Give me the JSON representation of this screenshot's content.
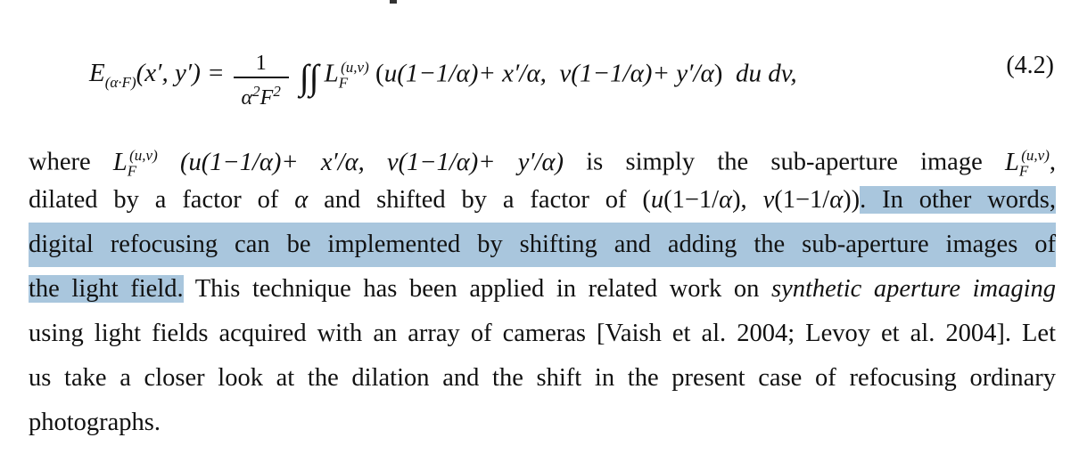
{
  "equation": {
    "lhs": "E(α·F)(x′, y′) =",
    "fraction_numerator": "1",
    "fraction_denominator": "α²F²",
    "integral": "∬",
    "rhs": "L_F^(u,v) (u(1−1/α)+ x′/α, v(1−1/α)+ y′/α) du dv,",
    "number": "(4.2)"
  },
  "paragraph": {
    "line1": "where L_F^(u,v) (u(1−1/α)+ x′/α, v(1−1/α)+ y′/α) is simply the sub-aperture image L_F^(u,v),",
    "line2_plain": "dilated by a factor of α and shifted by a factor of (u(1−1/α), v(1−1/α))",
    "line2_highlight": ". In other words,",
    "line3_highlight": "digital refocusing can be implemented by shifting and adding the sub-aperture images of",
    "line4_highlight": "the light field.",
    "line4_plain": " This technique has been applied in related work on",
    "line4_emphasis": "synthetic aperture imaging",
    "line5": "using light fields acquired with an array of cameras [Vaish et al. 2004; Levoy et al. 2004]. Let",
    "line6": "us take a closer look at the dilation and the shift in the present case of refocusing ordinary",
    "line7": "photographs."
  },
  "colors": {
    "highlight": "#a9c6dd",
    "text": "#111111",
    "background": "#ffffff"
  }
}
